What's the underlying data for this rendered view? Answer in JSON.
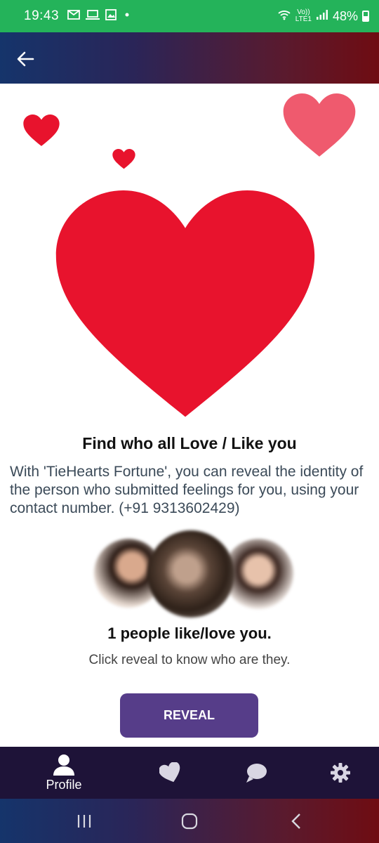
{
  "status_bar": {
    "time": "19:43",
    "left_icons": [
      "gmail-icon",
      "laptop-icon",
      "gallery-icon",
      "dot-icon"
    ],
    "volte_label": "Vo))",
    "lte_label": "LTE1",
    "battery": "48%"
  },
  "app_bar": {
    "back_icon": "arrow-left-icon"
  },
  "main": {
    "headline": "Find who all Love / Like you",
    "description": "With 'TieHearts Fortune', you can reveal the identity of the person who submitted feelings for you, using your contact number. (+91 9313602429)",
    "people_count": "1 people like/love you.",
    "people_sub": "Click reveal to know who are they.",
    "reveal_label": "REVEAL",
    "colors": {
      "heart_red": "#e8132d",
      "heart_pink": "#ef5a6e",
      "button_purple": "#563d89"
    }
  },
  "bottom_nav": {
    "items": [
      {
        "label": "Profile",
        "icon": "person-icon",
        "active": true
      },
      {
        "label": "",
        "icon": "heart-icon"
      },
      {
        "label": "",
        "icon": "chat-bubble-icon"
      },
      {
        "label": "",
        "icon": "gear-icon"
      }
    ]
  },
  "system_nav": {
    "icons": [
      "recent-apps-icon",
      "home-icon",
      "back-icon"
    ]
  }
}
